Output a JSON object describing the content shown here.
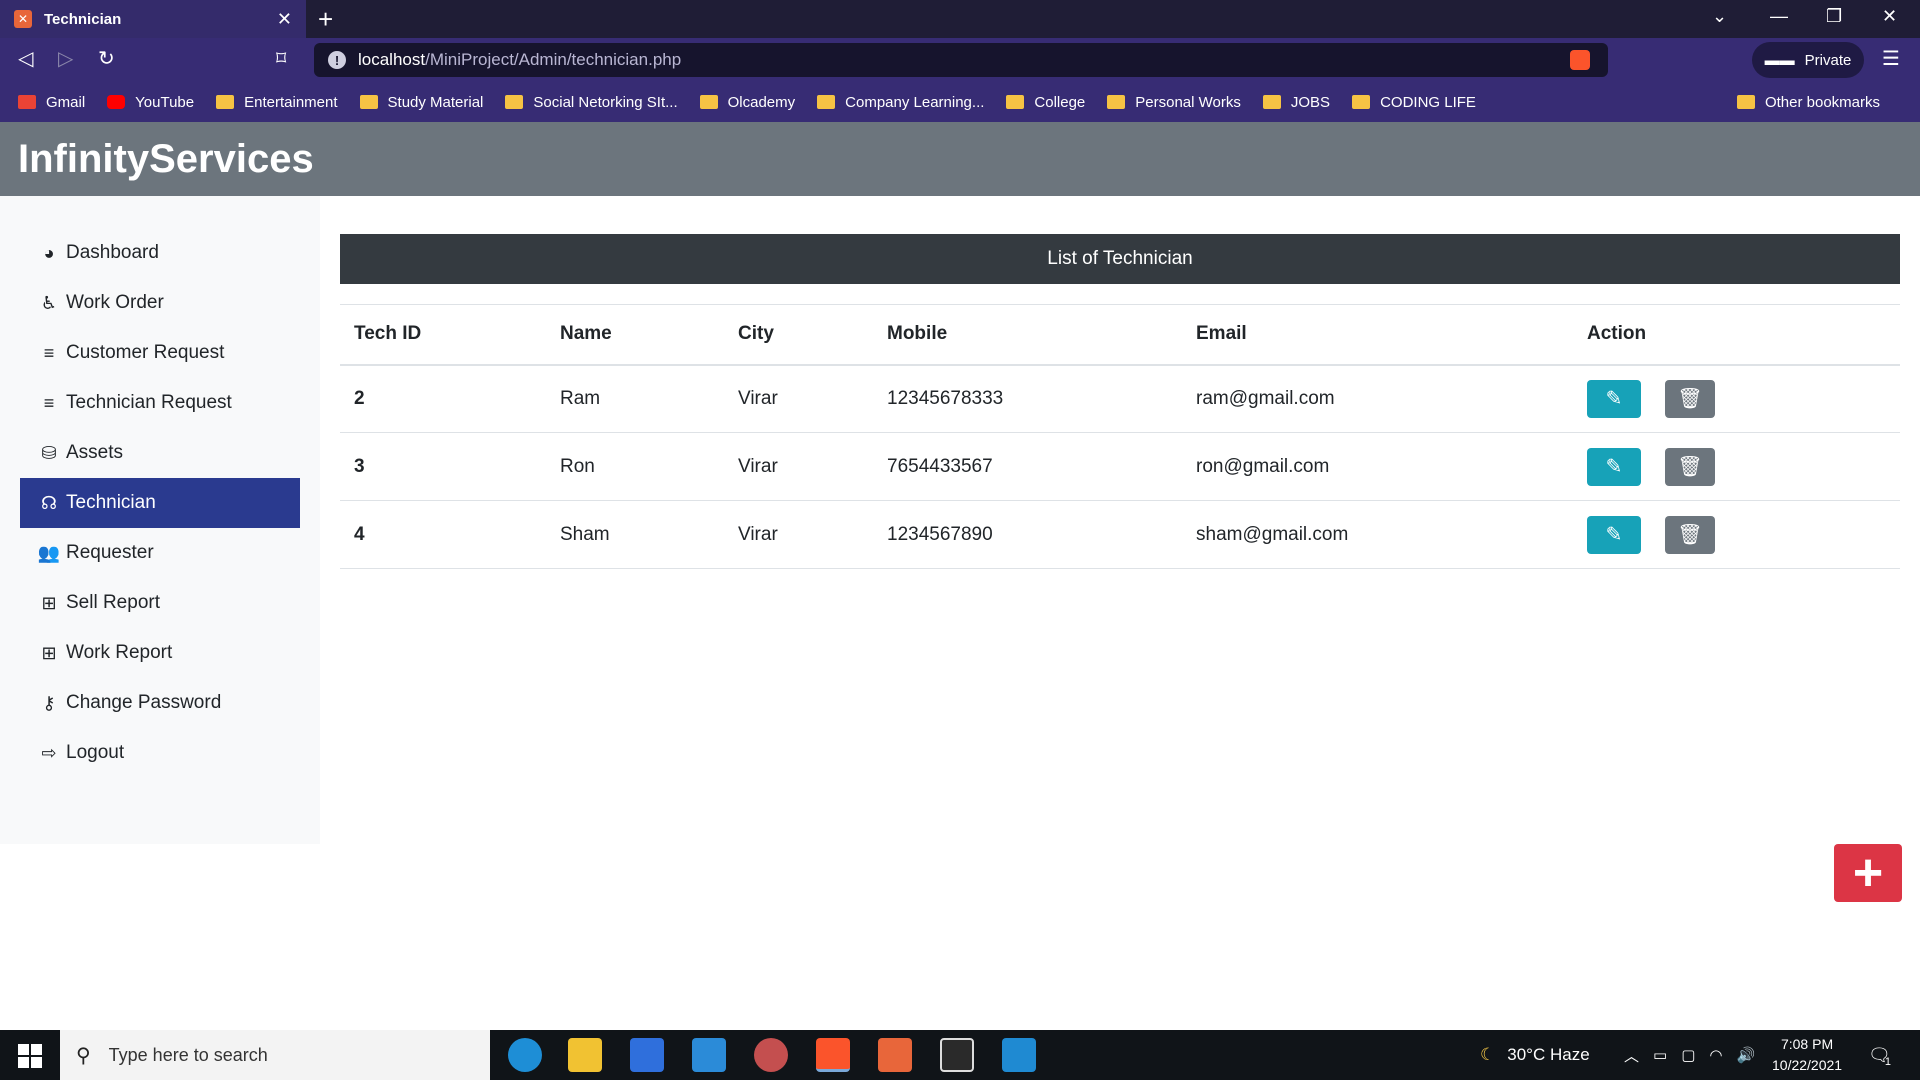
{
  "browser": {
    "tab_title": "Technician",
    "tab_favicon": "XAMPP",
    "url_host": "localhost",
    "url_path": "/MiniProject/Admin/technician.php",
    "private_label": "Private",
    "bookmarks": [
      "Gmail",
      "YouTube",
      "Entertainment",
      "Study Material",
      "Social Netorking SIt...",
      "Olcademy",
      "Company Learning...",
      "College",
      "Personal Works",
      "JOBS",
      "CODING LIFE"
    ],
    "other_bookmarks": "Other bookmarks"
  },
  "app": {
    "brand": "InfinityServices"
  },
  "sidebar": {
    "items": [
      {
        "label": "Dashboard",
        "icon": "tachometer-icon"
      },
      {
        "label": "Work Order",
        "icon": "accessibility-icon"
      },
      {
        "label": "Customer Request",
        "icon": "align-center-icon"
      },
      {
        "label": "Technician Request",
        "icon": "align-center-icon"
      },
      {
        "label": "Assets",
        "icon": "database-icon"
      },
      {
        "label": "Technician",
        "icon": "headset-icon",
        "active": true
      },
      {
        "label": "Requester",
        "icon": "users-icon"
      },
      {
        "label": "Sell Report",
        "icon": "table-icon"
      },
      {
        "label": "Work Report",
        "icon": "table-icon"
      },
      {
        "label": "Change Password",
        "icon": "key-icon"
      },
      {
        "label": "Logout",
        "icon": "sign-out-icon"
      }
    ]
  },
  "main": {
    "list_title": "List of Technician",
    "columns": [
      "Tech ID",
      "Name",
      "City",
      "Mobile",
      "Email",
      "Action"
    ],
    "rows": [
      {
        "id": "2",
        "name": "Ram",
        "city": "Virar",
        "mobile": "12345678333",
        "email": "ram@gmail.com"
      },
      {
        "id": "3",
        "name": "Ron",
        "city": "Virar",
        "mobile": "7654433567",
        "email": "ron@gmail.com"
      },
      {
        "id": "4",
        "name": "Sham",
        "city": "Virar",
        "mobile": "1234567890",
        "email": "sham@gmail.com"
      }
    ],
    "add_button": "+"
  },
  "taskbar": {
    "search_placeholder": "Type here to search",
    "weather": "30°C  Haze",
    "time": "7:08 PM",
    "date": "10/22/2021",
    "notification_count": "1"
  },
  "colors": {
    "header_bg": "#6c757d",
    "sidebar_active": "#2a3a8f",
    "list_header_bg": "#343a40",
    "edit_btn": "#17a2b8",
    "delete_btn": "#6c757d",
    "add_btn": "#dc3545"
  }
}
